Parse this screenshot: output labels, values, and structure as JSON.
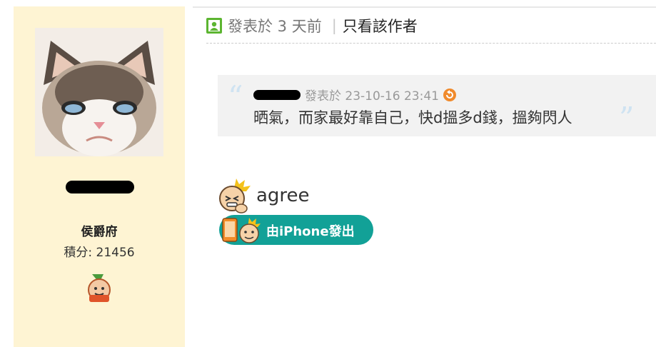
{
  "post": {
    "posted_text": "發表於 3 天前",
    "separator": "|",
    "author_only": "只看該作者"
  },
  "user": {
    "rank": "侯爵府",
    "points_label": "積分: 21456"
  },
  "quote": {
    "meta": "發表於 23-10-16 23:41",
    "text": "晒氣，而家最好靠自己，快d搵多d錢，搵夠閃人",
    "open_mark": "“",
    "close_mark": "”"
  },
  "reply": {
    "text": "agree",
    "badge_text": "由iPhone發出"
  },
  "colors": {
    "sidebar_bg": "#fef4d3",
    "quote_bg": "#f2f2f2",
    "badge_bg": "#12a197",
    "user_icon": "#5cb531"
  },
  "icons": [
    "user-icon",
    "back-arrow-icon",
    "medal-2023-icon",
    "emoji-face-icon",
    "iphone-icon"
  ]
}
